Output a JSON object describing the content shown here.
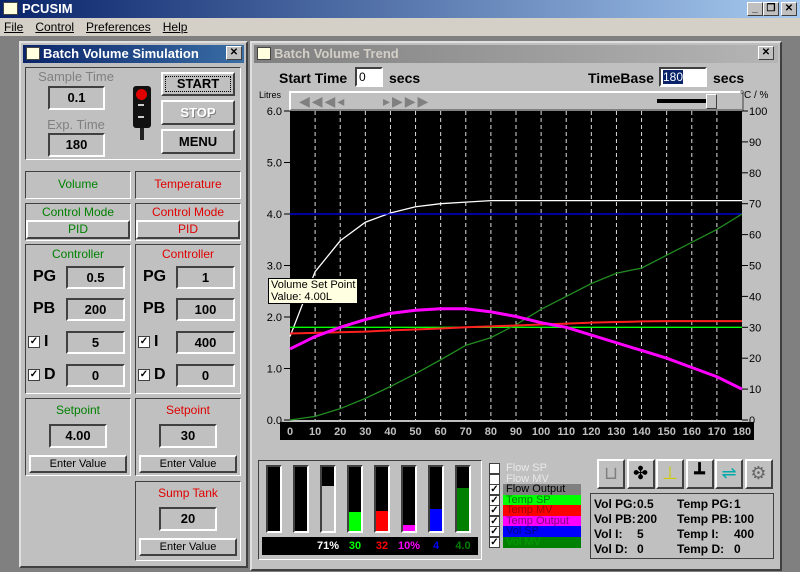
{
  "app": {
    "title": "PCUSIM",
    "menu": [
      "File",
      "Control",
      "Preferences",
      "Help"
    ]
  },
  "sim": {
    "title": "Batch Volume Simulation",
    "sample_time_label": "Sample Time",
    "sample_time": "0.1",
    "exp_time_label": "Exp. Time",
    "exp_time": "180",
    "start": "START",
    "stop": "STOP",
    "menu": "MENU",
    "vol": {
      "header": "Volume",
      "mode_label": "Control Mode",
      "mode": "PID",
      "controller": "Controller",
      "pg_label": "PG",
      "pg": "0.5",
      "pb_label": "PB",
      "pb": "200",
      "i_label": "I",
      "i": "5",
      "d_label": "D",
      "d": "0",
      "setpoint_label": "Setpoint",
      "setpoint": "4.00",
      "enter": "Enter Value"
    },
    "temp": {
      "header": "Temperature",
      "mode_label": "Control Mode",
      "mode": "PID",
      "controller": "Controller",
      "pg_label": "PG",
      "pg": "1",
      "pb_label": "PB",
      "pb": "100",
      "i_label": "I",
      "i": "400",
      "d_label": "D",
      "d": "0",
      "setpoint_label": "Setpoint",
      "setpoint": "30",
      "enter": "Enter Value"
    },
    "sump": {
      "label": "Sump Tank",
      "value": "20",
      "enter": "Enter Value"
    }
  },
  "trend": {
    "title": "Batch Volume Trend",
    "start_label": "Start Time",
    "start": "0",
    "secs": "secs",
    "timebase_label": "TimeBase",
    "timebase": "180",
    "tooltip_line1": "Volume Set Point",
    "tooltip_line2": "Value: 4.00L",
    "bars": [
      {
        "fill": 0,
        "label": "",
        "color": "#000000"
      },
      {
        "fill": 0,
        "label": "",
        "color": "#000000"
      },
      {
        "fill": 0.71,
        "label": "71%",
        "color": "#c0c0c0"
      },
      {
        "fill": 0.3,
        "label": "30",
        "color": "#00ff00"
      },
      {
        "fill": 0.32,
        "label": "32",
        "color": "#ff0000"
      },
      {
        "fill": 0.1,
        "label": "10%",
        "color": "#ff00ff"
      },
      {
        "fill": 0.34,
        "label": "4",
        "color": "#0000ff"
      },
      {
        "fill": 0.67,
        "label": "4.0",
        "color": "#008000"
      }
    ],
    "legend": [
      {
        "label": "Flow SP",
        "checked": false,
        "bg": "#c0c0c0",
        "fg": "#e8e8e8"
      },
      {
        "label": "Flow MV",
        "checked": false,
        "bg": "#c0c0c0",
        "fg": "#e8e8e8"
      },
      {
        "label": "Flow Output",
        "checked": true,
        "bg": "#808080",
        "fg": "#000000"
      },
      {
        "label": "Temp SP",
        "checked": true,
        "bg": "#00ff00",
        "fg": "#008000"
      },
      {
        "label": "Temp MV",
        "checked": true,
        "bg": "#ff0000",
        "fg": "#a00000"
      },
      {
        "label": "Temp Output",
        "checked": true,
        "bg": "#ff00ff",
        "fg": "#800080"
      },
      {
        "label": "Vol SP",
        "checked": true,
        "bg": "#0000ff",
        "fg": "#000080"
      },
      {
        "label": "Vol MV",
        "checked": true,
        "bg": "#008000",
        "fg": "#00a000"
      }
    ],
    "tools": [
      "tank-icon",
      "fan-icon",
      "valve-icon",
      "mixer-icon",
      "pipe-valve-icon",
      "pump-icon"
    ],
    "params": [
      [
        "Vol PG:",
        "0.5",
        "Temp PG:",
        "1"
      ],
      [
        "Vol PB:",
        "200",
        "Temp PB:",
        "100"
      ],
      [
        "Vol I:",
        "5",
        "Temp I:",
        "400"
      ],
      [
        "Vol D:",
        "0",
        "Temp D:",
        "0"
      ]
    ]
  },
  "chart_data": {
    "type": "line",
    "ylabel": "Litres",
    "y2label": "°C / %",
    "xlim": [
      0,
      180
    ],
    "ylim": [
      0,
      6
    ],
    "y2lim": [
      0,
      100
    ],
    "xticks": [
      "0",
      "10",
      "20",
      "30",
      "40",
      "50",
      "60",
      "70",
      "80",
      "90",
      "100",
      "110",
      "120",
      "130",
      "140",
      "150",
      "160",
      "170",
      "180"
    ],
    "yticks": [
      "0.0",
      "1.0",
      "2.0",
      "3.0",
      "4.0",
      "5.0",
      "6.0"
    ],
    "y2ticks": [
      "0",
      "10",
      "20",
      "30",
      "40",
      "50",
      "60",
      "70",
      "80",
      "90",
      "100"
    ],
    "x": [
      0,
      10,
      20,
      30,
      40,
      50,
      60,
      70,
      80,
      90,
      100,
      110,
      120,
      130,
      140,
      150,
      160,
      170,
      180
    ],
    "series": [
      {
        "name": "Flow Output",
        "axis": "right",
        "color": "#ffffff",
        "values": [
          27,
          48,
          58,
          64,
          67,
          69,
          70,
          70.5,
          71,
          71,
          71,
          71,
          71,
          71,
          71,
          71,
          71,
          71,
          71
        ]
      },
      {
        "name": "Vol SP",
        "axis": "left",
        "color": "#0000ff",
        "values": [
          4,
          4,
          4,
          4,
          4,
          4,
          4,
          4,
          4,
          4,
          4,
          4,
          4,
          4,
          4,
          4,
          4,
          4,
          4
        ]
      },
      {
        "name": "Temp SP",
        "axis": "right",
        "color": "#00ff00",
        "values": [
          30,
          30,
          30,
          30,
          30,
          30,
          30,
          30,
          30,
          30,
          30,
          30,
          30,
          30,
          30,
          30,
          30,
          30,
          30
        ]
      },
      {
        "name": "Vol MV",
        "axis": "left",
        "color": "#228b22",
        "values": [
          0,
          0.07,
          0.22,
          0.42,
          0.65,
          0.9,
          1.17,
          1.45,
          1.6,
          1.85,
          2.15,
          2.4,
          2.65,
          2.85,
          2.95,
          3.2,
          3.45,
          3.7,
          4.0
        ]
      },
      {
        "name": "Temp MV",
        "axis": "right",
        "color": "#ff2020",
        "values": [
          28,
          28.2,
          28.4,
          28.6,
          29,
          29.3,
          29.6,
          30,
          30.3,
          30.6,
          30.9,
          31.2,
          31.5,
          31.7,
          31.9,
          32,
          32,
          32,
          32
        ]
      },
      {
        "name": "Temp Output",
        "axis": "right",
        "color": "#ff00ff",
        "values": [
          23,
          27,
          30,
          32.5,
          34.5,
          35.5,
          36,
          36,
          35,
          33.5,
          31.5,
          30,
          27.5,
          25,
          22.5,
          20,
          17,
          14,
          10
        ]
      }
    ]
  }
}
